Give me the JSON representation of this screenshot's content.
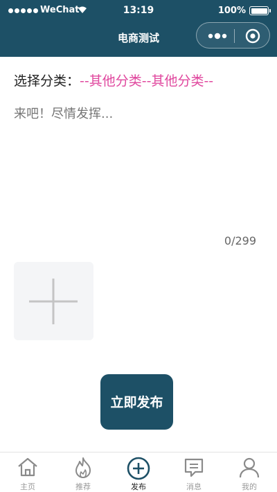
{
  "status_bar": {
    "carrier": "WeChat",
    "time": "13:19",
    "battery": "100%"
  },
  "nav": {
    "title": "电商测试"
  },
  "form": {
    "category_label": "选择分类：",
    "category_value": "--其他分类--其他分类--",
    "content_placeholder": "来吧！尽情发挥...",
    "content_value": "",
    "counter": "0/299",
    "publish_label": "立即发布"
  },
  "tabbar": {
    "items": [
      {
        "label": "主页",
        "icon": "home-icon"
      },
      {
        "label": "推荐",
        "icon": "flame-icon"
      },
      {
        "label": "发布",
        "icon": "plus-circle-icon"
      },
      {
        "label": "消息",
        "icon": "message-icon"
      },
      {
        "label": "我的",
        "icon": "user-icon"
      }
    ],
    "active_index": 2
  },
  "colors": {
    "brand": "#1d5066",
    "category_accent": "#e0479e"
  }
}
